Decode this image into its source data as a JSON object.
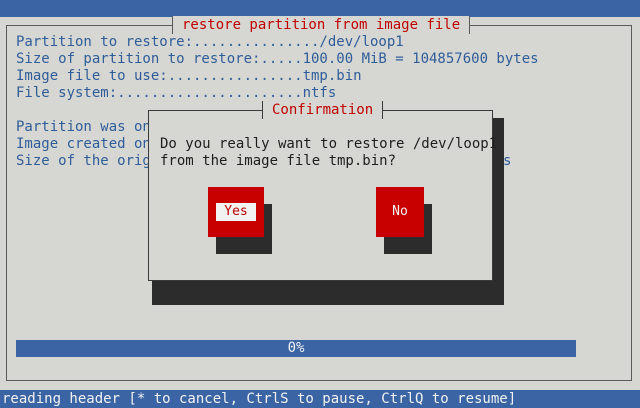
{
  "window": {
    "title": "restore partition from image file"
  },
  "info": {
    "partition_line": "Partition to restore:.............../dev/loop1",
    "size_line": "Size of partition to restore:.....100.00 MiB = 104857600 bytes",
    "image_line": "Image file to use:................tmp.bin",
    "fs_line": "File system:......................ntfs",
    "saved_line": "Partition was on",
    "created_line": "Image created on",
    "orig_size_line": "Size of the orig",
    "orig_size_tail": "s"
  },
  "dialog": {
    "title": "Confirmation",
    "line1": "Do you really want to restore /dev/loop1",
    "line2": "from the image file tmp.bin?",
    "yes_label": "Yes",
    "no_label": "No",
    "selected": "Yes"
  },
  "progress": {
    "label": "0%",
    "percent": 0
  },
  "status": {
    "text": "reading header [* to cancel, CtrlS to pause, CtrlQ to resume]"
  },
  "colors": {
    "accent": "#3a64a4",
    "title_red": "#c00000",
    "button_red": "#c80000",
    "background": "#d6d6d2"
  }
}
